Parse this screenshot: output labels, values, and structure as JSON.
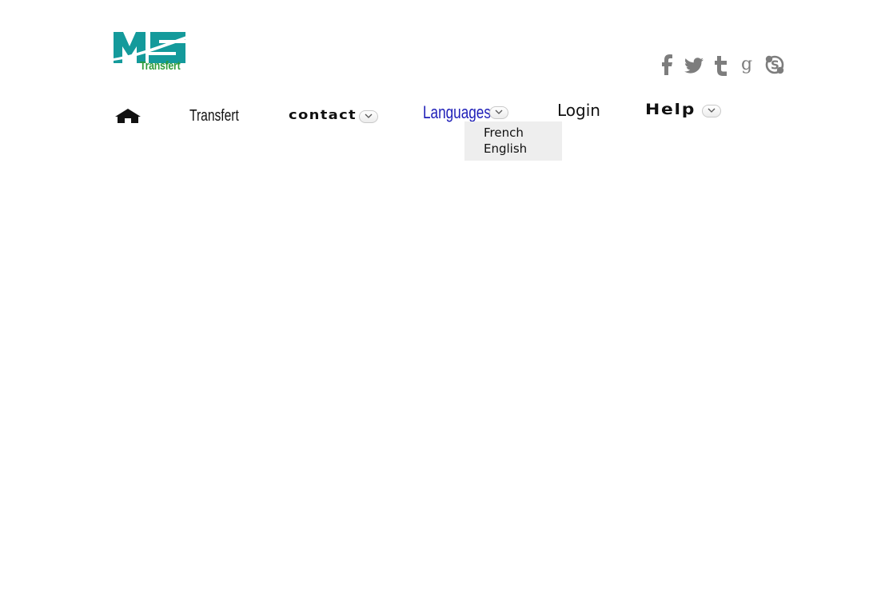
{
  "logo": {
    "mark": "MS",
    "subtitle": "Transfert",
    "colors": {
      "teal": "#149a9b",
      "green": "#2e9b3a"
    }
  },
  "social": [
    {
      "name": "facebook-icon"
    },
    {
      "name": "twitter-icon"
    },
    {
      "name": "tumblr-icon"
    },
    {
      "name": "google-icon"
    },
    {
      "name": "skype-icon"
    }
  ],
  "nav": {
    "home_icon": "home-icon",
    "transfert": "Transfert",
    "contact": "contact",
    "languages": "Languages",
    "login": "Login",
    "help": "Help"
  },
  "languages_menu": {
    "items": [
      "French",
      "English"
    ]
  },
  "colors": {
    "languages_accent": "#1f1fb8",
    "icon_gray": "#808080",
    "dropdown_bg": "#eeeeee"
  }
}
